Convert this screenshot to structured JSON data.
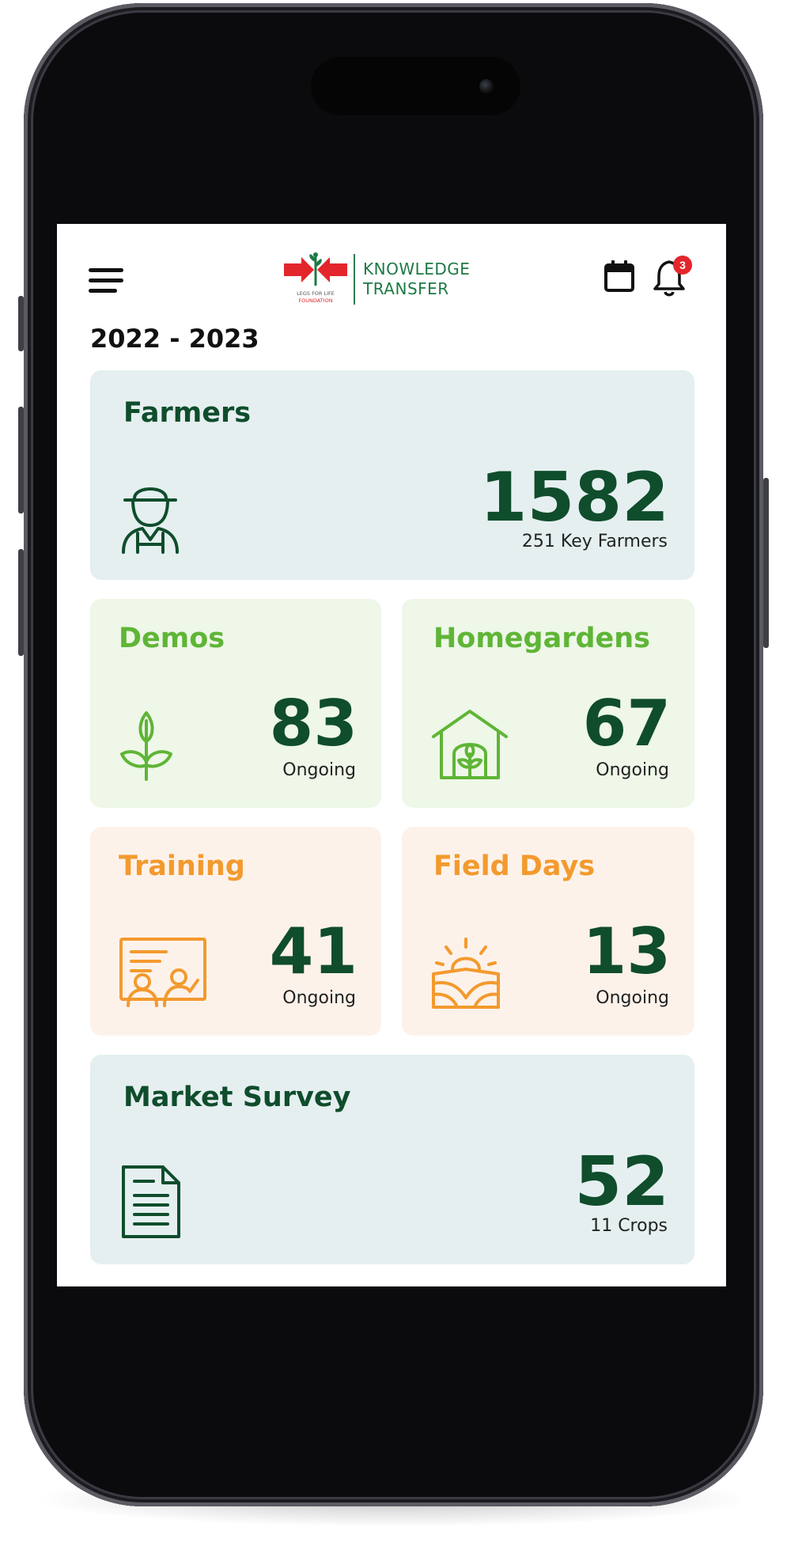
{
  "colors": {
    "dark_green": "#0f4d2c",
    "light_green": "#5fb536",
    "orange": "#f39a2e",
    "badge_red": "#e3262c",
    "blue_gray_card": "#e5eff0",
    "green_card": "#eef7e8",
    "orange_card": "#fdf2ea"
  },
  "header": {
    "logo_title_line1": "KNOWLEDGE",
    "logo_title_line2": "TRANSFER",
    "logo_small_line1": "LEGS FOR LIFE",
    "logo_small_line2": "FOUNDATION",
    "notification_count": "3",
    "icons": [
      "menu-icon",
      "calendar-icon",
      "bell-icon"
    ]
  },
  "period": "2022 - 2023",
  "cards": {
    "farmers": {
      "title": "Farmers",
      "value": "1582",
      "sub": "251 Key Farmers",
      "icon": "farmer-icon"
    },
    "demos": {
      "title": "Demos",
      "value": "83",
      "sub": "Ongoing",
      "icon": "sprout-icon"
    },
    "homegardens": {
      "title": "Homegardens",
      "value": "67",
      "sub": "Ongoing",
      "icon": "greenhouse-icon"
    },
    "training": {
      "title": "Training",
      "value": "41",
      "sub": "Ongoing",
      "icon": "presentation-icon"
    },
    "field_days": {
      "title": "Field Days",
      "value": "13",
      "sub": "Ongoing",
      "icon": "sunrise-field-icon"
    },
    "market_survey": {
      "title": "Market Survey",
      "value": "52",
      "sub": "11 Crops",
      "icon": "document-icon"
    }
  }
}
